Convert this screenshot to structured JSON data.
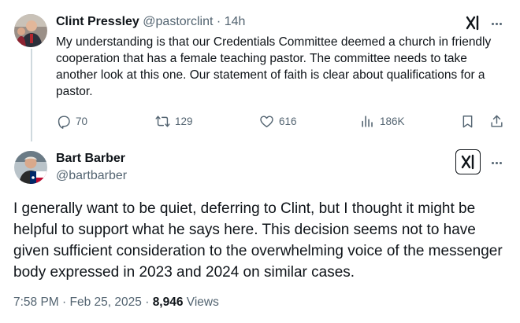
{
  "parent_post": {
    "author_name": "Clint Pressley",
    "author_handle": "@pastorclint",
    "separator": "·",
    "time_ago": "14h",
    "text": "My understanding is that our Credentials Committee deemed a church in friendly cooperation that has a female teaching pastor. The committee needs to take another look at this one. Our statement of faith is clear about qualifications for a pastor.",
    "actions": {
      "replies": "70",
      "reposts": "129",
      "likes": "616",
      "views": "186K"
    }
  },
  "main_post": {
    "author_name": "Bart Barber",
    "author_handle": "@bartbarber",
    "text": "I generally want to be quiet, deferring to Clint, but I thought it might be helpful to support what he says here. This decision seems not to have given sufficient consideration to the overwhelming voice of the messenger body expressed in 2023 and 2024 on similar cases.",
    "time": "7:58 PM",
    "separator1": "·",
    "date": "Feb 25, 2025",
    "separator2": "·",
    "views_count": "8,946",
    "views_label": "Views"
  },
  "icons": {
    "grok": "grok-icon",
    "more": "more-options-icon",
    "reply": "reply-icon",
    "repost": "repost-icon",
    "like": "heart-icon",
    "views": "analytics-icon",
    "bookmark": "bookmark-icon",
    "share": "share-icon"
  },
  "colors": {
    "text": "#0f1419",
    "muted": "#536471",
    "thread_line": "#cfd9de"
  }
}
